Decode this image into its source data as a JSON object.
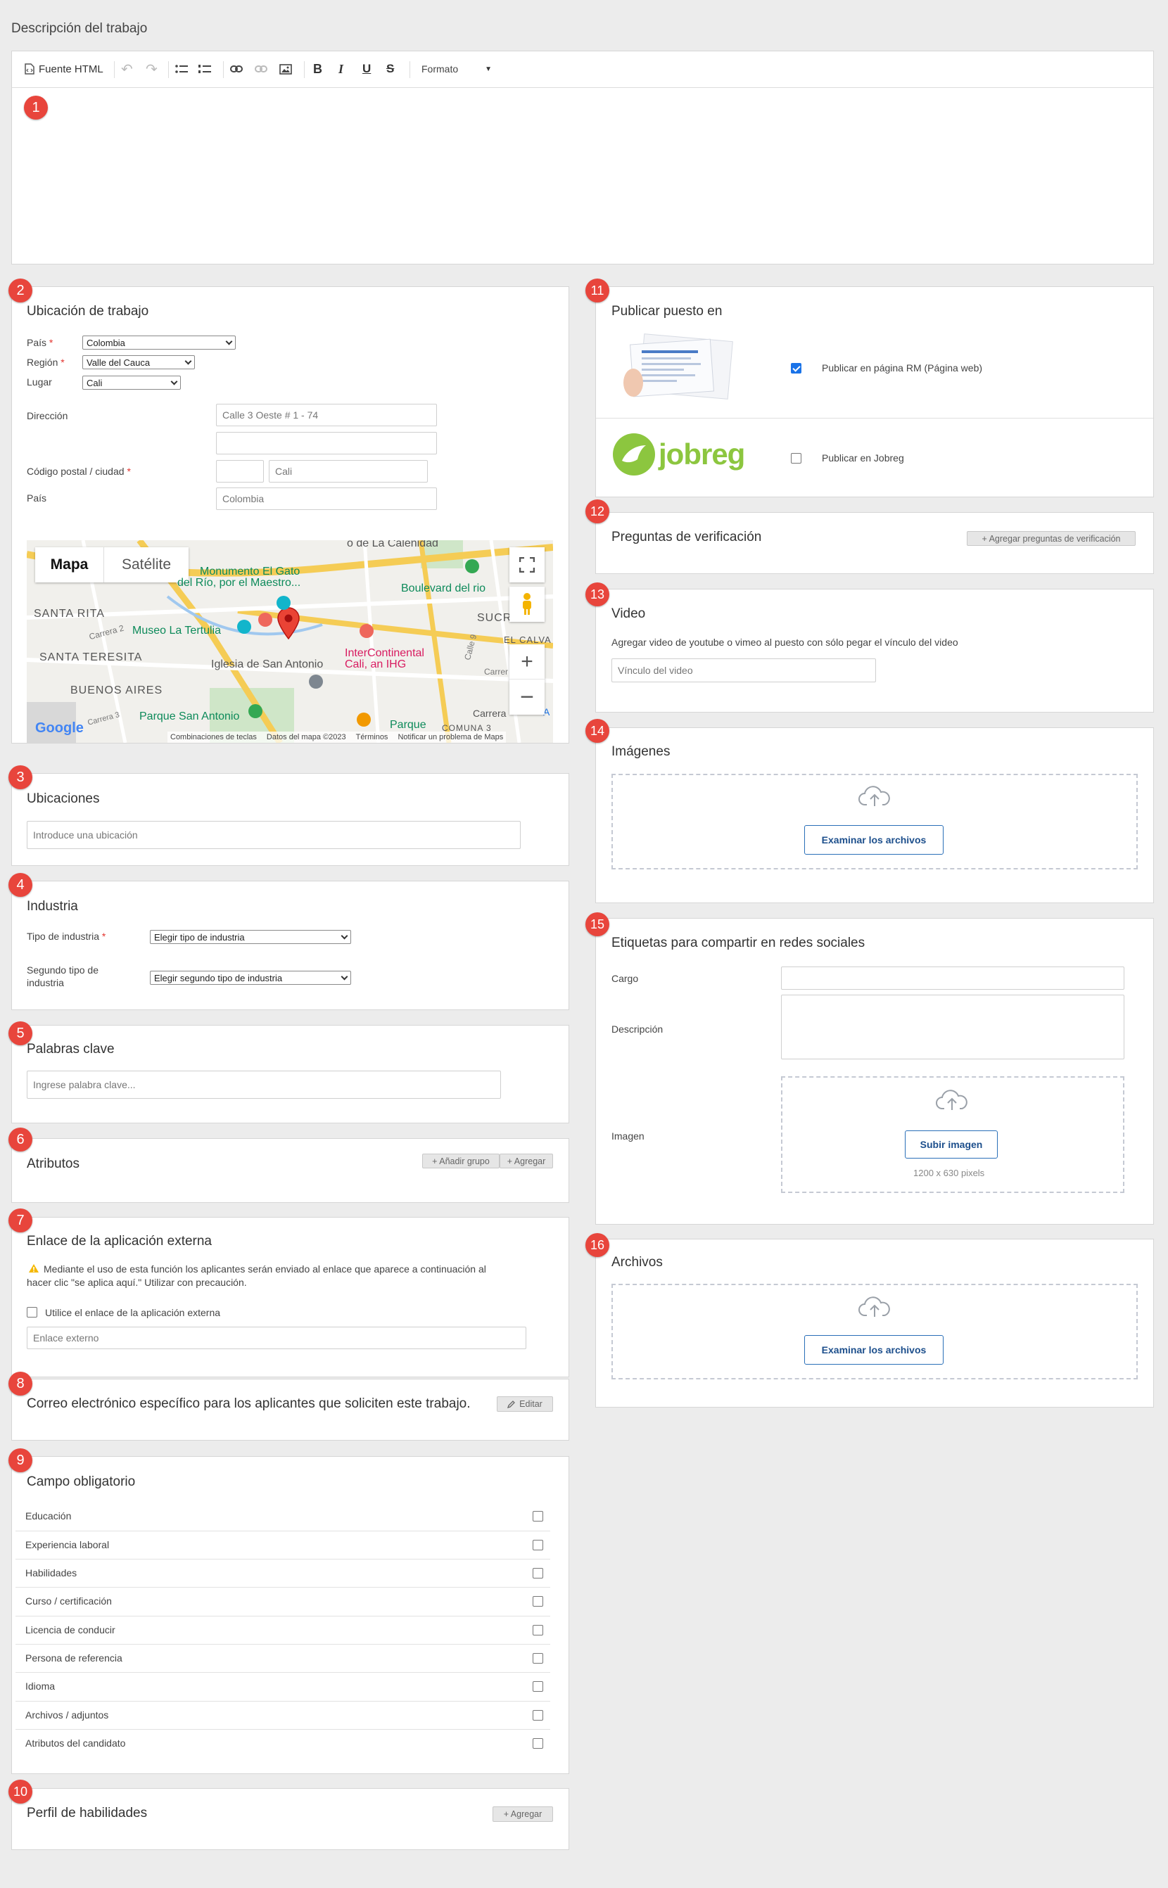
{
  "description": {
    "label": "Descripción del trabajo",
    "toolbar": {
      "source": "Fuente HTML",
      "format": "Formato"
    }
  },
  "location": {
    "title": "Ubicación de trabajo",
    "country_label": "País",
    "country": "Colombia",
    "region_label": "Región",
    "region": "Valle del Cauca",
    "place_label": "Lugar",
    "place": "Cali",
    "address_label": "Dirección",
    "address": "Calle 3 Oeste # 1 - 74",
    "postal_label": "Código postal / ciudad",
    "city": "Cali",
    "country2_label": "País",
    "country2": "Colombia"
  },
  "map": {
    "tab_map": "Mapa",
    "tab_sat": "Satélite",
    "places": {
      "calenidad": "o de La Calenidad",
      "gato1": "Monumento El Gato",
      "gato2": "del Río, por el Maestro...",
      "boulevard": "Boulevard del rio",
      "santarita": "SANTA RITA",
      "sucre": "SUCRE",
      "tertulia": "Museo La Tertulia",
      "calva": "EL CALVA",
      "carrera2": "Carrera 2",
      "teresita": "SANTA TERESITA",
      "iglesia": "Iglesia de San Antonio",
      "interc1": "InterContinental",
      "interc2": "Cali, an IHG",
      "calle9": "Calle 9",
      "carrera": "Carrer",
      "buenos": "BUENOS AIRES",
      "parque": "Parque San Antonio",
      "parque2": "Parque",
      "comuna": "COMUNA 3",
      "carrera3": "Carrera 3",
      "carrera_b": "Carrera",
      "a": "A"
    },
    "footer": {
      "keys": "Combinaciones de teclas",
      "data": "Datos del mapa ©2023",
      "terms": "Términos",
      "report": "Notificar un problema de Maps"
    },
    "google": "Google"
  },
  "ubicaciones": {
    "title": "Ubicaciones",
    "placeholder": "Introduce una ubicación"
  },
  "industry": {
    "title": "Industria",
    "type_label": "Tipo de industria",
    "type_value": "Elegir tipo de industria",
    "second_label_1": "Segundo tipo de",
    "second_label_2": "industria",
    "second_value": "Elegir segundo tipo de industria"
  },
  "keywords": {
    "title": "Palabras clave",
    "placeholder": "Ingrese palabra clave..."
  },
  "attributes": {
    "title": "Atributos",
    "add_group": "+ Añadir grupo",
    "add": "+ Agregar"
  },
  "external": {
    "title": "Enlace de la aplicación externa",
    "warning_1": "Mediante el uso de esta función los aplicantes serán enviado al enlace que aparece a continuación al",
    "warning_2": "hacer clic \"se aplica aquí.\" Utilizar con precaución.",
    "checkbox": "Utilice el enlace de la aplicación externa",
    "placeholder": "Enlace externo"
  },
  "email": {
    "title": "Correo electrónico específico para los aplicantes que soliciten este trabajo.",
    "edit": "Editar"
  },
  "mandatory": {
    "title": "Campo obligatorio",
    "items": [
      "Educación",
      "Experiencia laboral",
      "Habilidades",
      "Curso / certificación",
      "Licencia de conducir",
      "Persona de referencia",
      "Idioma",
      "Archivos / adjuntos",
      "Atributos del candidato"
    ]
  },
  "skills": {
    "title": "Perfil de habilidades",
    "add": "+ Agregar"
  },
  "publish": {
    "title": "Publicar puesto en",
    "rm": "Publicar en página RM (Página web)",
    "rm_checked": true,
    "jobreg": "Publicar en Jobreg",
    "jobreg_checked": false,
    "jobreg_logo": "jobreg"
  },
  "verify": {
    "title": "Preguntas de verificación",
    "add": "+ Agregar preguntas de verificación"
  },
  "video": {
    "title": "Video",
    "help": "Agregar video de youtube o vimeo al puesto con sólo pegar el vínculo del video",
    "placeholder": "Vínculo del video"
  },
  "images": {
    "title": "Imágenes",
    "button": "Examinar los archivos"
  },
  "social": {
    "title": "Etiquetas para compartir en redes sociales",
    "cargo": "Cargo",
    "desc": "Descripción",
    "imagen": "Imagen",
    "upload": "Subir imagen",
    "size": "1200 x 630 pixels"
  },
  "files": {
    "title": "Archivos",
    "button": "Examinar los archivos"
  },
  "badges": [
    "1",
    "2",
    "3",
    "4",
    "5",
    "6",
    "7",
    "8",
    "9",
    "10",
    "11",
    "12",
    "13",
    "14",
    "15",
    "16"
  ],
  "colors": {
    "badge": "#e8453c",
    "accent": "#1d4f8c",
    "check": "#1a73e8",
    "jobreg_green": "#8cc63f"
  }
}
